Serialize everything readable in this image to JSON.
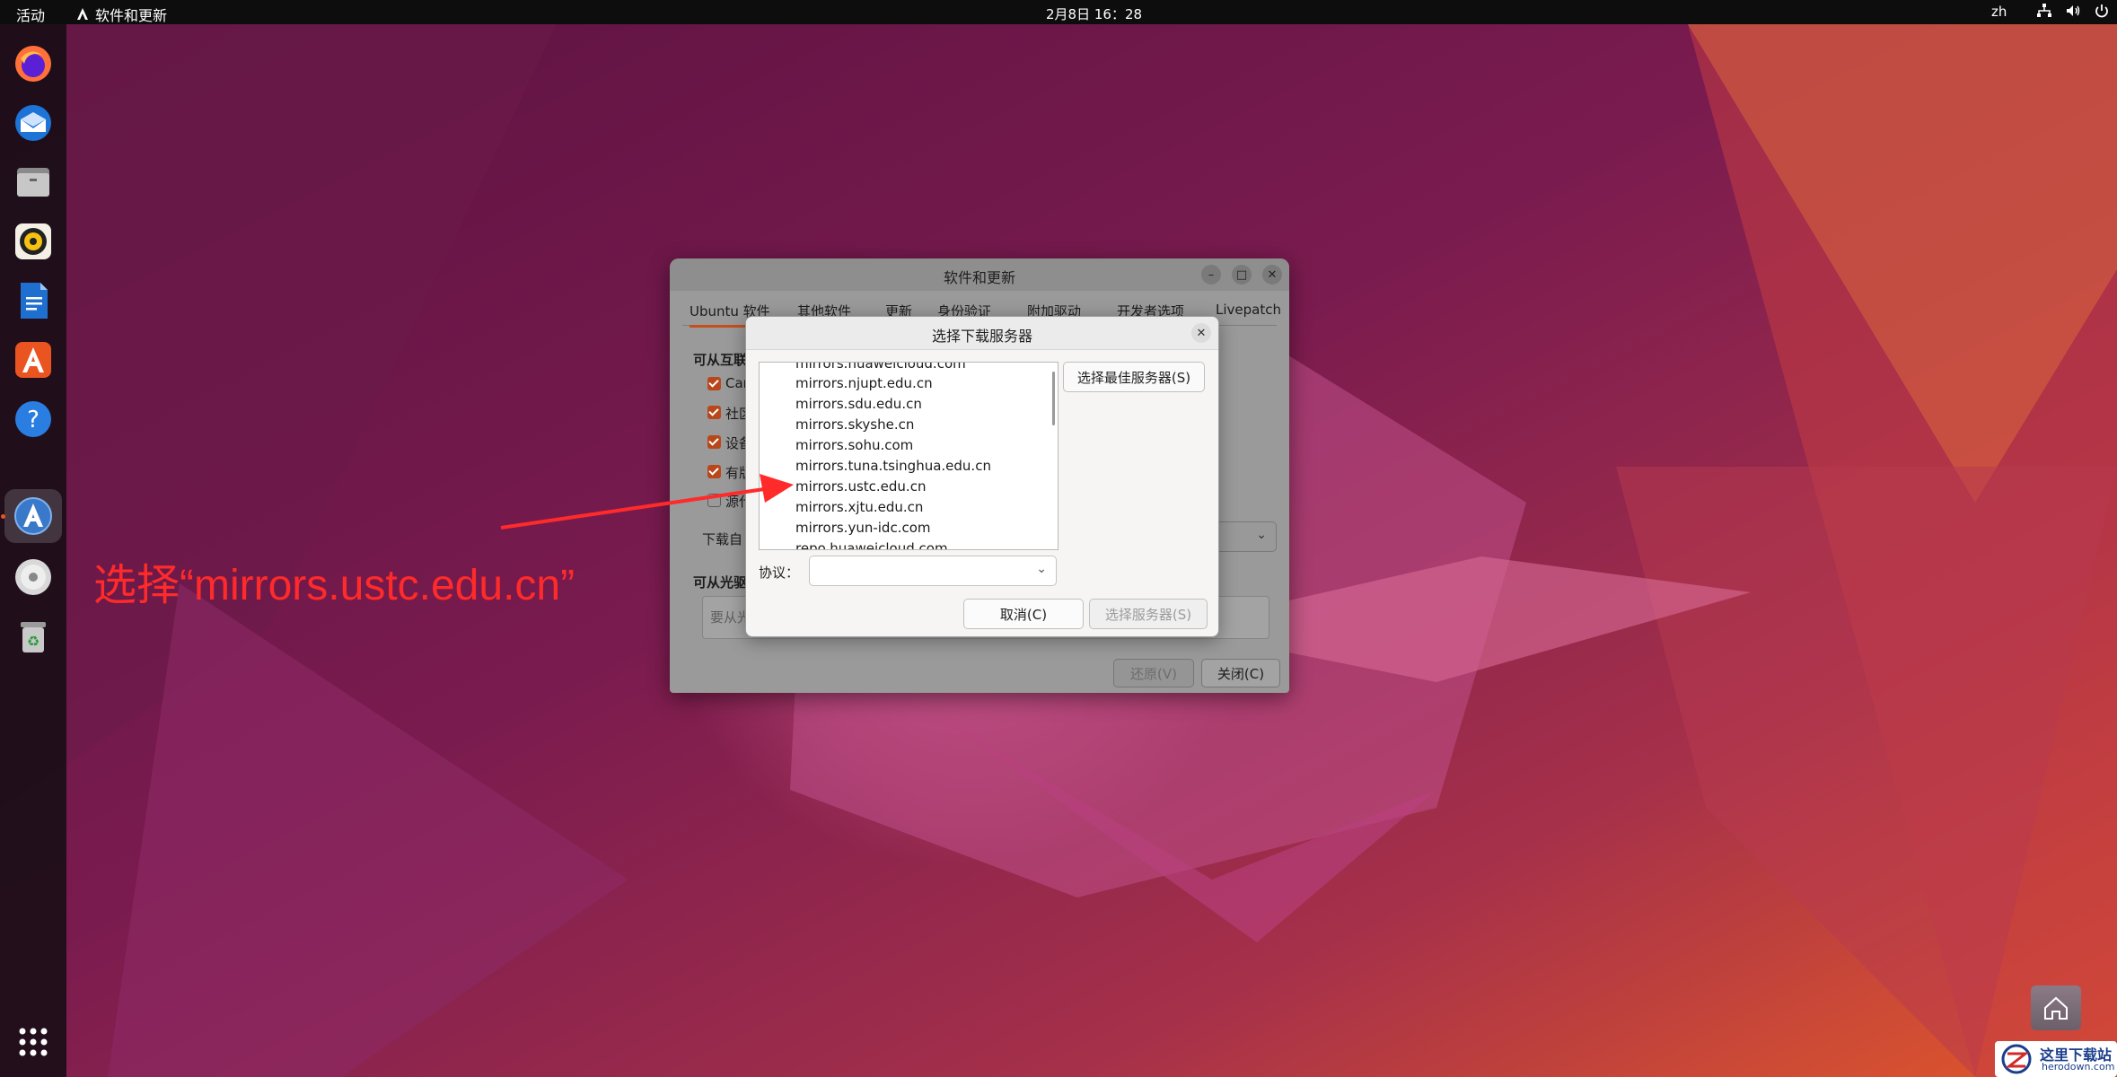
{
  "topbar": {
    "activities": "活动",
    "app_name": "软件和更新",
    "clock": "2月8日 16：28",
    "lang": "zh"
  },
  "dock": {
    "items": [
      "firefox-icon",
      "thunderbird-icon",
      "files-icon",
      "rhythmbox-icon",
      "libreoffice-writer-icon",
      "app-center-icon",
      "help-icon",
      "software-updater-icon",
      "dvd-icon",
      "trash-icon",
      "show-apps-icon"
    ]
  },
  "main_window": {
    "title": "软件和更新",
    "tabs": [
      "Ubuntu 软件",
      "其他软件",
      "更新",
      "身份验证",
      "附加驱动",
      "开发者选项",
      "Livepatch"
    ],
    "section_internet": "可从互联",
    "checkboxes": [
      {
        "label": "Car",
        "checked": true
      },
      {
        "label": "社区",
        "checked": true
      },
      {
        "label": "设备",
        "checked": true
      },
      {
        "label": "有版",
        "checked": true
      },
      {
        "label": "源代",
        "checked": false
      }
    ],
    "download_from": "下载自",
    "section_cdrom": "可从光驱",
    "cdrom_placeholder": "要从光",
    "revert_button": "还原(V)",
    "close_button": "关闭(C)"
  },
  "mirror_dialog": {
    "title": "选择下载服务器",
    "mirrors": [
      "mirrors.huaweicloud.com",
      "mirrors.njupt.edu.cn",
      "mirrors.sdu.edu.cn",
      "mirrors.skyshe.cn",
      "mirrors.sohu.com",
      "mirrors.tuna.tsinghua.edu.cn",
      "mirrors.ustc.edu.cn",
      "mirrors.xjtu.edu.cn",
      "mirrors.yun-idc.com",
      "repo.huaweicloud.com"
    ],
    "best_server_button": "选择最佳服务器(S)",
    "protocol_label": "协议：",
    "protocol_value": "",
    "cancel_button": "取消(C)",
    "choose_button": "选择服务器(S)"
  },
  "annotation": {
    "text": "选择“mirrors.ustc.edu.cn”",
    "color": "#ff2a2a"
  },
  "watermark": {
    "text": "这里下载站",
    "subtext": "herodown.com"
  }
}
